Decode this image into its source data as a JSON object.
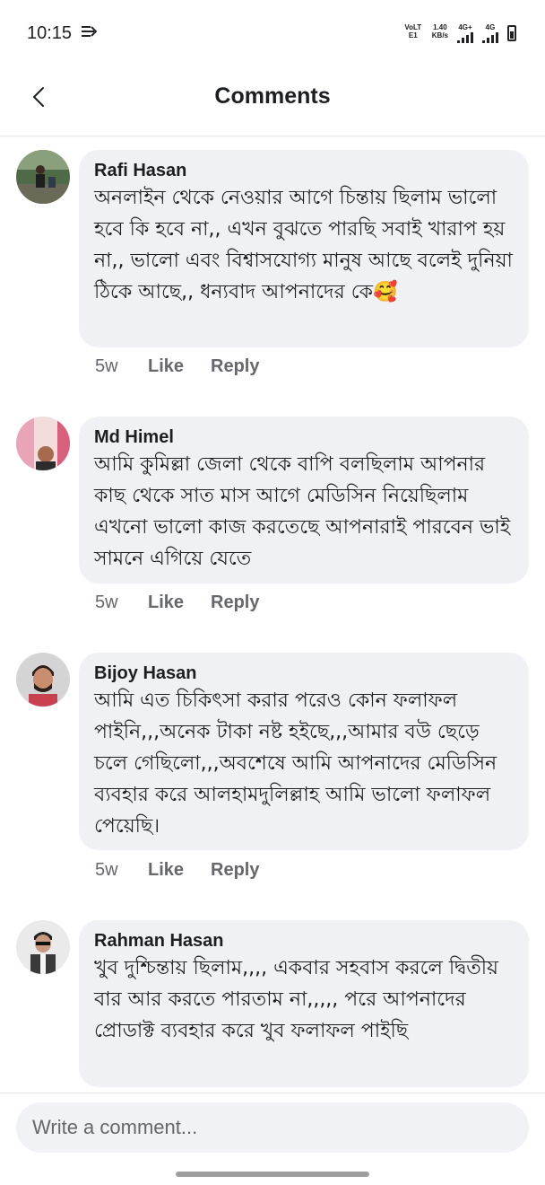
{
  "status_bar": {
    "time": "10:15",
    "volte_label": "VoLTE1",
    "speed_value": "1.40",
    "speed_unit": "KB/s",
    "net1_label": "4G+",
    "net2_label": "4G"
  },
  "header": {
    "title": "Comments",
    "back_icon": "chevron-left-icon"
  },
  "comments": [
    {
      "author": "Rafi Hasan",
      "text": "অনলাইন থেকে নেওয়ার আগে চিন্তায় ছিলাম ভালো হবে কি হবে না,, এখন বুঝতে পারছি সবাই খারাপ হয় না,, ভালো এবং বিশ্বাসযোগ্য মানুষ আছে বলেই দুনিয়া ঠিকে আছে,, ধন্যবাদ আপনাদের কে🥰",
      "age": "5w",
      "like": "Like",
      "reply": "Reply"
    },
    {
      "author": "Md Himel",
      "text": "আমি কুমিল্লা জেলা থেকে বাপি বলছিলাম আপনার কাছ থেকে সাত মাস আগে মেডিসিন নিয়েছিলাম এখনো ভালো কাজ করতেছে আপনারাই পারবেন ভাই সামনে এগিয়ে যেতে",
      "age": "5w",
      "like": "Like",
      "reply": "Reply"
    },
    {
      "author": "Bijoy Hasan",
      "text": "আমি এত চিকিৎসা করার পরেও কোন ফলাফল পাইনি,,,অনেক টাকা নষ্ট হইছে,,,আমার বউ ছেড়ে চলে গেছিলো,,,অবশেষে আমি আপনাদের মেডিসিন ব্যবহার করে আলহামদুলিল্লাহ আমি ভালো ফলাফল পেয়েছি।",
      "age": "5w",
      "like": "Like",
      "reply": "Reply"
    },
    {
      "author": "Rahman Hasan",
      "text": "খুব দুশ্চিন্তায় ছিলাম,,,, একবার সহবাস করলে দ্বিতীয় বার আর করতে পারতাম না,,,,, পরে আপনাদের প্রোডাক্ট ব্যবহার করে খুব ফলাফল পাইছি"
    }
  ],
  "composer": {
    "placeholder": "Write a comment..."
  },
  "colors": {
    "bubble": "#eff1f4",
    "secondary_text": "#65676b",
    "primary_text": "#1c1e21"
  }
}
